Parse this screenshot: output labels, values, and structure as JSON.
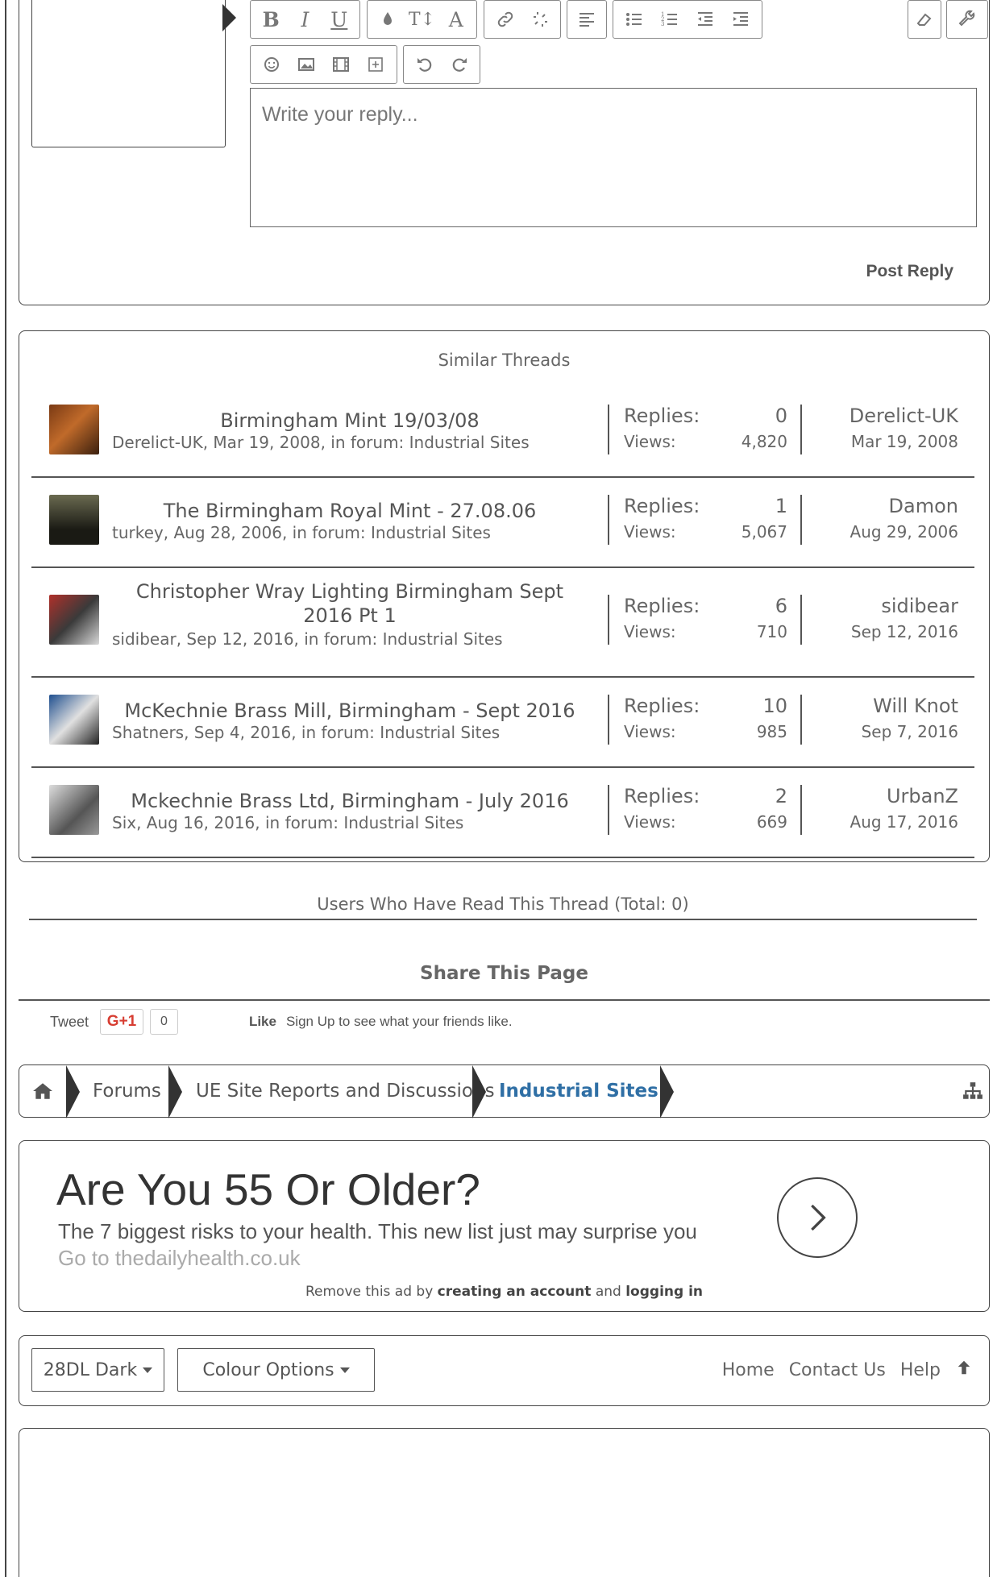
{
  "editor": {
    "placeholder": "Write your reply...",
    "post_reply_label": "Post Reply"
  },
  "similar": {
    "title": "Similar Threads",
    "replies_label": "Replies:",
    "views_label": "Views:",
    "threads": [
      {
        "title": "Birmingham Mint 19/03/08",
        "meta": "Derelict-UK, Mar 19, 2008, in forum: Industrial Sites",
        "replies": "0",
        "views": "4,820",
        "last_user": "Derelict-UK",
        "last_date": "Mar 19, 2008"
      },
      {
        "title": "The Birmingham Royal Mint - 27.08.06",
        "meta": "turkey, Aug 28, 2006, in forum: Industrial Sites",
        "replies": "1",
        "views": "5,067",
        "last_user": "Damon",
        "last_date": "Aug 29, 2006"
      },
      {
        "title": "Christopher Wray Lighting Birmingham Sept 2016 Pt 1",
        "meta": "sidibear, Sep 12, 2016, in forum: Industrial Sites",
        "replies": "6",
        "views": "710",
        "last_user": "sidibear",
        "last_date": "Sep 12, 2016"
      },
      {
        "title": "McKechnie Brass Mill, Birmingham - Sept 2016",
        "meta": "Shatners, Sep 4, 2016, in forum: Industrial Sites",
        "replies": "10",
        "views": "985",
        "last_user": "Will Knot",
        "last_date": "Sep 7, 2016"
      },
      {
        "title": "Mckechnie Brass Ltd, Birmingham - July 2016",
        "meta": "Six, Aug 16, 2016, in forum: Industrial Sites",
        "replies": "2",
        "views": "669",
        "last_user": "UrbanZ",
        "last_date": "Aug 17, 2016"
      }
    ]
  },
  "readers": {
    "text": "Users Who Have Read This Thread (Total: 0)"
  },
  "share": {
    "title": "Share This Page",
    "tweet": "Tweet",
    "gplus": "G+1",
    "gplus_count": "0",
    "like": "Like",
    "like_text": "Sign Up to see what your friends like."
  },
  "breadcrumb": {
    "items": [
      "Forums",
      "UE Site Reports and Discussions",
      "Industrial Sites"
    ]
  },
  "ad": {
    "headline": "Are You 55 Or Older?",
    "subline": "The 7 biggest risks to your health. This new list just may surprise you",
    "url": "Go to thedailyhealth.co.uk",
    "remove_prefix": "Remove this ad by",
    "remove_link1": "creating an account",
    "remove_and": "and",
    "remove_link2": "logging in"
  },
  "footer": {
    "style_label": "28DL Dark",
    "colour_label": "Colour Options",
    "links": [
      "Home",
      "Contact Us",
      "Help"
    ]
  },
  "colors": {
    "accent": "#2f6fa5",
    "border": "#444444",
    "text": "#555555",
    "gplus_red": "#d73d32"
  }
}
